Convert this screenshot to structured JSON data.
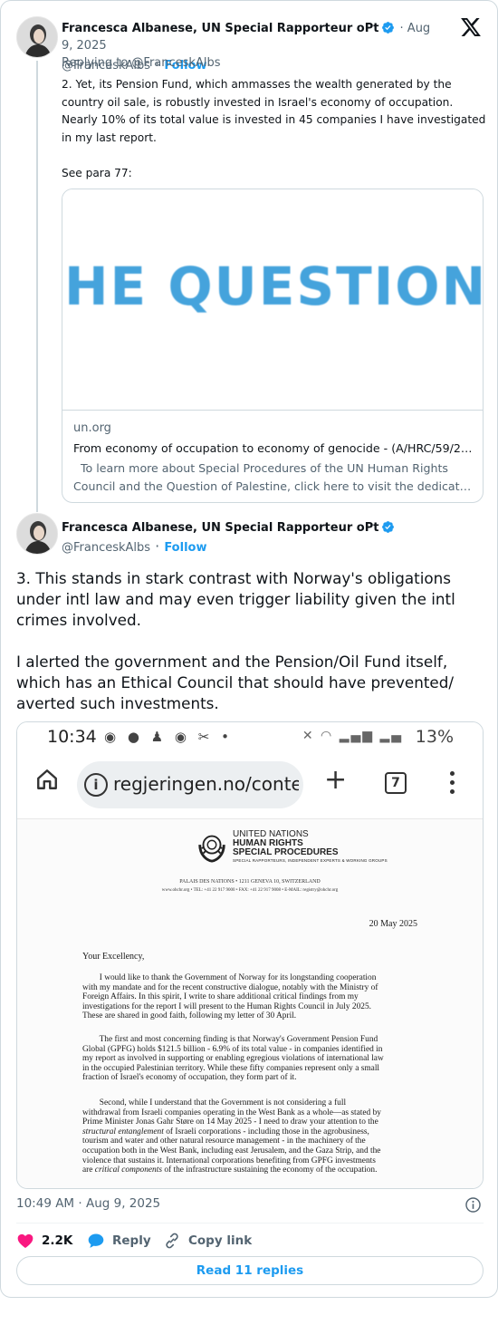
{
  "tweet1": {
    "author_name": "Francesca Albanese, UN Special Rapporteur oPt",
    "handle": "@FranceskAlbs",
    "follow_label": "Follow",
    "date": "Aug 9, 2025",
    "replying_to": "Replying to @FranceskAlbs",
    "text_lines": [
      "2. Yet, its Pension Fund, which ammasses the wealth generated by the",
      "country oil sale, is robustly invested in Israel's economy of occupation.",
      "Nearly 10% of its total value is invested in 45 companies I have investigated",
      "in my last report."
    ],
    "text_extra": "See para 77:",
    "link_card": {
      "image_text": "HE QUESTION",
      "domain": "un.org",
      "title": "From economy of occupation to economy of genocide - (A/HRC/59/23...",
      "description_lines": [
        "  To learn more about Special Procedures of the UN Human Rights",
        "Council and the Question of Palestine, click here to visit the dedicated ..."
      ]
    }
  },
  "tweet2": {
    "author_name": "Francesca Albanese, UN Special Rapporteur oPt",
    "handle": "@FranceskAlbs",
    "follow_label": "Follow",
    "paragraphs": [
      "3. This stands in stark contrast with Norway's obligations under intl law and may even trigger liability given the intl crimes involved.",
      "I alerted the government and the Pension/Oil Fund itself, which has an Ethical Council that should have prevented/ averted such investments."
    ],
    "timestamp": "10:49 AM · Aug 9, 2025",
    "likes": "2.2K",
    "reply_label": "Reply",
    "copy_label": "Copy link",
    "read_replies_label": "Read 11 replies"
  },
  "screenshot": {
    "status_time": "10:34",
    "status_battery": "13%",
    "url_text": "regjeringen.no/conte",
    "tab_count": "7",
    "letterhead": {
      "line1": "UNITED NATIONS",
      "line2": "HUMAN RIGHTS",
      "line3": "SPECIAL PROCEDURES",
      "line4": "SPECIAL RAPPORTEURS, INDEPENDENT EXPERTS & WORKING GROUPS"
    },
    "address": "PALAIS DES NATIONS • 1211 GENEVA 10, SWITZERLAND",
    "contact": "www.ohchr.org • TEL: +41 22 917 9000 • FAX: +41 22 917 9008 • E-MAIL: registry@ohchr.org",
    "letter_date": "20 May 2025",
    "salutation": "Your Excellency,",
    "para1": [
      "        I would like to thank the Government of Norway for its longstanding cooperation",
      "with my mandate and for the recent constructive dialogue, notably with the Ministry of",
      "Foreign Affairs. In this spirit, I write to share additional critical findings from my",
      "investigations for the report I will present to the Human Rights Council in July 2025.",
      "These are shared in good faith, following my letter of 30 April."
    ],
    "para2": [
      "        The first and most concerning finding is that Norway's Government Pension Fund",
      "Global (GPFG) holds $121.5 billion - 6.9% of its total value - in companies identified in",
      "my report as involved in supporting or enabling egregious violations of international law",
      "in the occupied Palestinian territory. While these fifty companies represent only a small",
      "fraction of Israel's economy of occupation, they form part of it."
    ],
    "para3": [
      "        Second, while I understand that the Government is not considering a full",
      "withdrawal from Israeli companies operating in the West Bank as a whole—as stated by",
      "Prime Minister Jonas Gahr Støre on 14 May 2025 - I need to draw your attention to the",
      "structural entanglement of Israeli corporations - including those in the agrobusiness,",
      "tourism and water and other natural resource management - in the machinery of the",
      "occupation both in the West Bank, including east Jerusalem, and the Gaza Strip, and the",
      "violence that sustains it. International corporations benefiting from GPFG investments",
      "are critical components of the infrastructure sustaining the economy of the occupation."
    ]
  },
  "colors": {
    "accent": "#1d9bf0",
    "like": "#f91880",
    "muted": "#536471"
  }
}
